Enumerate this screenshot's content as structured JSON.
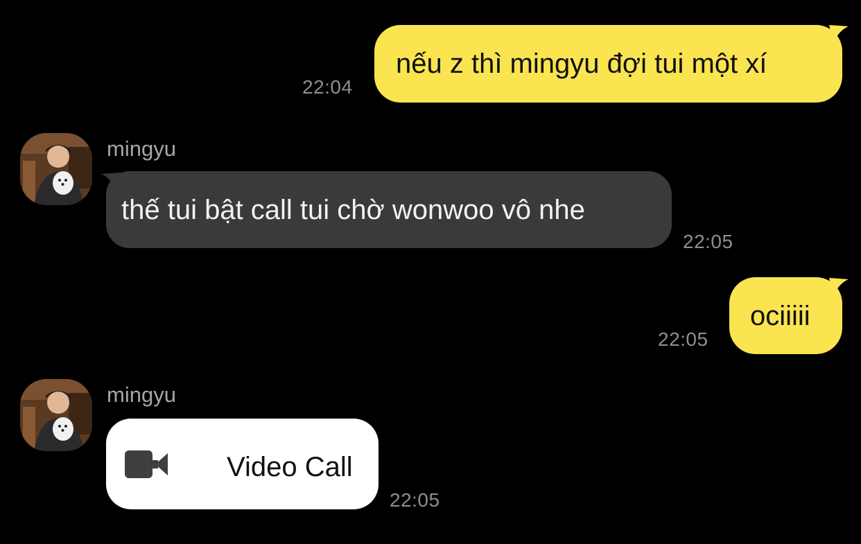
{
  "messages": [
    {
      "direction": "outgoing",
      "text": "nếu z thì mingyu đợi tui một xí",
      "time": "22:04"
    },
    {
      "direction": "incoming",
      "sender": "mingyu",
      "text": "thế tui bật call tui chờ wonwoo vô nhe",
      "time": "22:05"
    },
    {
      "direction": "outgoing",
      "text": "ociiiii",
      "time": "22:05"
    },
    {
      "direction": "incoming",
      "sender": "mingyu",
      "call": {
        "label": "Video Call",
        "icon": "video-camera-icon"
      },
      "time": "22:05"
    }
  ],
  "colors": {
    "background": "#000000",
    "outgoing_bubble": "#fae450",
    "incoming_bubble": "#3a3a3c",
    "call_card": "#ffffff",
    "timestamp": "#8e8e93",
    "sender_name": "#a6a6aa"
  }
}
